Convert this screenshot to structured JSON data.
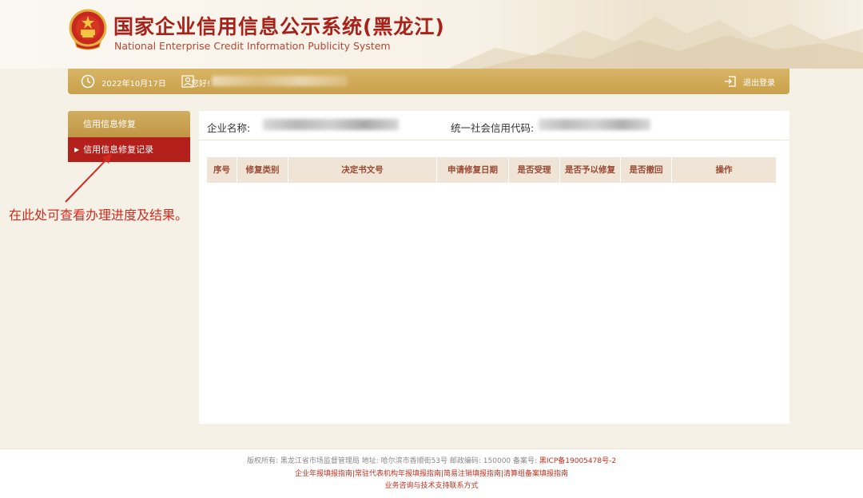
{
  "header": {
    "title": "国家企业信用信息公示系统(黑龙江)",
    "subtitle": "National Enterprise Credit Information Publicity System"
  },
  "topbar": {
    "date": "2022年10月17日",
    "greeting": "您好!",
    "logout_label": "退出登录"
  },
  "sidebar": {
    "heading": "信用信息修复",
    "items": [
      {
        "label": "信用信息修复记录",
        "active": true
      }
    ]
  },
  "annotation": {
    "text": "在此处可查看办理进度及结果。",
    "color": "#d42a1f"
  },
  "main": {
    "company_label": "企业名称:",
    "credit_code_label": "统一社会信用代码:",
    "table": {
      "columns": [
        "序号",
        "修复类别",
        "决定书文号",
        "申请修复日期",
        "是否受理",
        "是否予以修复",
        "是否撤回",
        "操作"
      ],
      "rows": []
    }
  },
  "footer": {
    "line1_prefix": "版权所有:  黑龙江省市场监督管理局 地址:  哈尔滨市香顺街53号 邮政编码:  150000 备案号:  ",
    "icp": "黑ICP备19005478号-2",
    "line2": "企业年报填报指南|常驻代表机构年报填报指南|简易注销填报指南|清算组备案填报指南",
    "line3": "业务咨询与技术支持联系方式"
  },
  "colors": {
    "brand_red": "#a8221a",
    "gold": "#c9a04b",
    "sidebar_active": "#b3201b",
    "table_header_bg": "#efe4d6"
  },
  "icons": [
    "national-emblem-icon",
    "clock-icon",
    "user-icon",
    "logout-icon",
    "triangle-right-icon"
  ]
}
